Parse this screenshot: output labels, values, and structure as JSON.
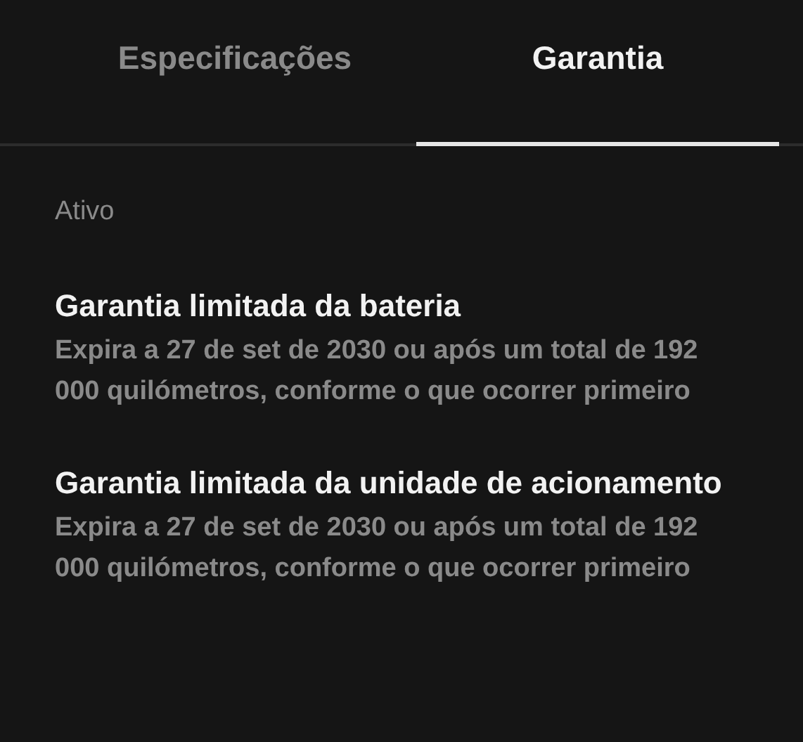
{
  "tabs": [
    {
      "label": "Especificações",
      "selected": false
    },
    {
      "label": "Garantia",
      "selected": true
    }
  ],
  "section": {
    "heading": "Ativo"
  },
  "warranties": [
    {
      "title": "Garantia limitada da bateria",
      "description": "Expira a 27 de set de 2030 ou após um total de 192 000 quilómetros, conforme o que ocorrer primeiro"
    },
    {
      "title": "Garantia limitada da unidade de acionamento",
      "description": "Expira a 27 de set de 2030 ou após um total de 192 000 quilómetros, conforme o que ocorrer primeiro"
    }
  ]
}
